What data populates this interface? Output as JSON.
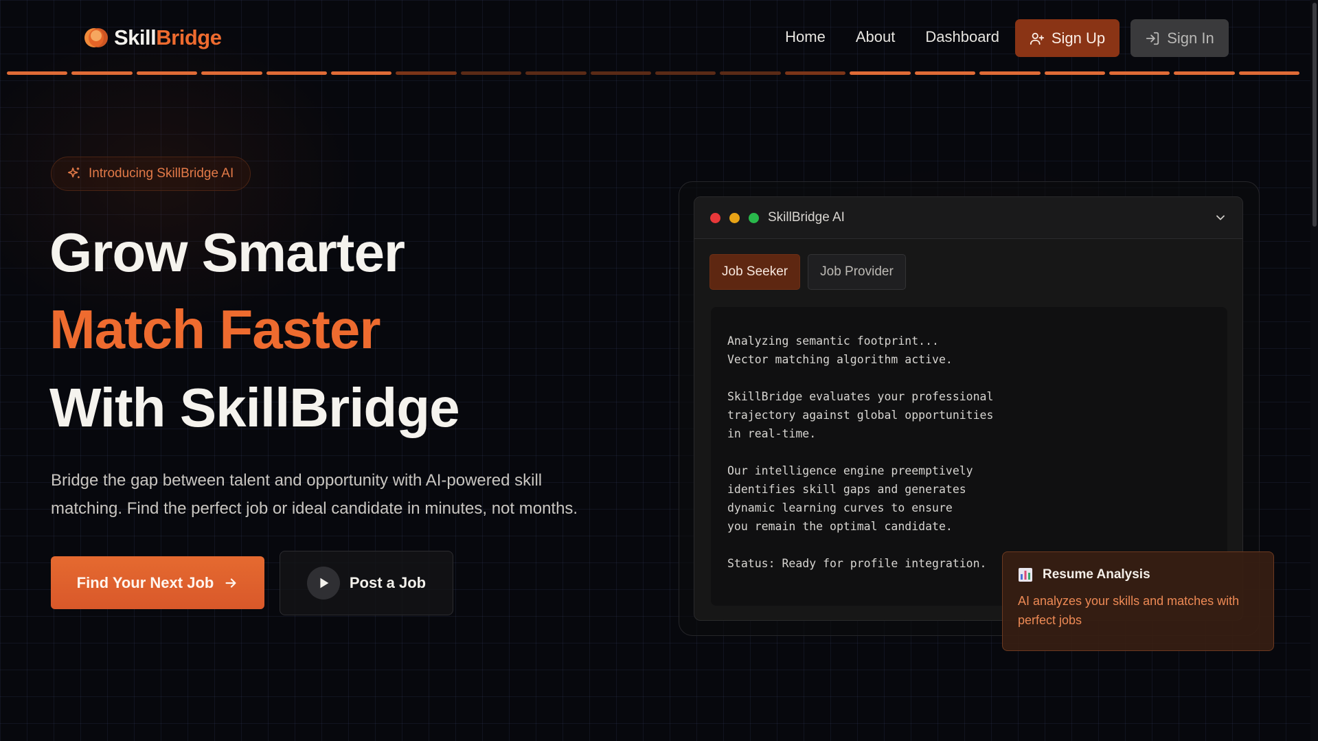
{
  "header": {
    "logo": {
      "part1": "Skill",
      "part2": "Bridge"
    },
    "nav": [
      {
        "label": "Home"
      },
      {
        "label": "About"
      },
      {
        "label": "Dashboard"
      }
    ],
    "sign_up_label": "Sign Up",
    "sign_in_label": "Sign In"
  },
  "hero": {
    "badge": "Introducing SkillBridge AI",
    "line1": "Grow Smarter",
    "line2": "Match Faster",
    "line3": "With SkillBridge",
    "lead": "Bridge the gap between talent and opportunity with AI-powered skill matching. Find the perfect job or ideal candidate in minutes, not months.",
    "primary_cta": "Find Your Next Job",
    "secondary_cta": "Post a Job"
  },
  "ai_panel": {
    "title": "SkillBridge AI",
    "tabs": [
      {
        "label": "Job Seeker",
        "active": true
      },
      {
        "label": "Job Provider",
        "active": false
      }
    ],
    "terminal_text": "Analyzing semantic footprint...\nVector matching algorithm active.\n\nSkillBridge evaluates your professional\ntrajectory against global opportunities\nin real-time.\n\nOur intelligence engine preemptively\nidentifies skill gaps and generates\ndynamic learning curves to ensure\nyou remain the optimal candidate.\n\nStatus: Ready for profile integration."
  },
  "feature_card": {
    "title": "Resume Analysis",
    "text": "AI analyzes your skills and matches with perfect jobs"
  },
  "colors": {
    "accent": "#ee6b2f",
    "background": "#07080d",
    "panel": "#171717",
    "sign_up_bg": "#8a3415",
    "sign_in_bg": "#3a3a3c"
  },
  "icons": {
    "logo": "logo-icon",
    "sign_up": "user-plus-icon",
    "sign_in": "sign-in-icon",
    "badge": "sparkles-icon",
    "arrow": "arrow-right-icon",
    "play": "play-icon",
    "chevron": "chevron-down-icon",
    "chart": "bar-chart-icon"
  }
}
